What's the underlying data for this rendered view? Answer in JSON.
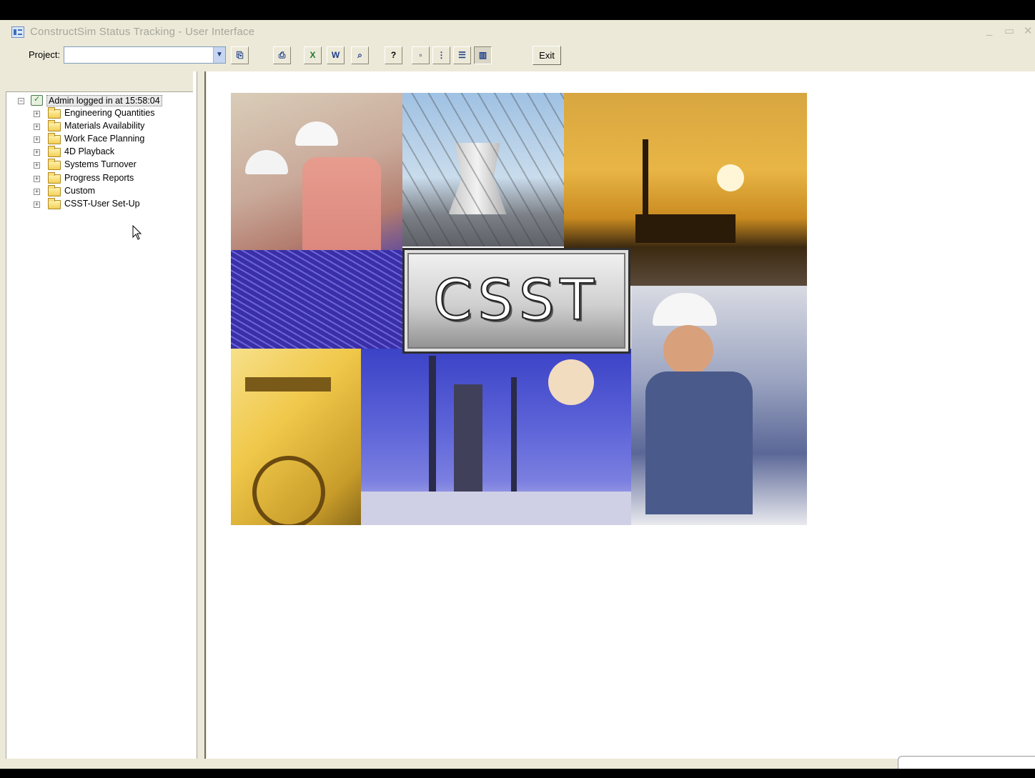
{
  "window": {
    "title": "ConstructSim Status Tracking - User Interface",
    "controls": {
      "minimize": "_",
      "maximize": "▭",
      "close": "✕"
    }
  },
  "toolbar": {
    "project_label": "Project:",
    "project_value": "",
    "exit_label": "Exit",
    "buttons": [
      {
        "name": "open-project-button",
        "glyph": "⎘"
      },
      {
        "name": "print-button",
        "glyph": "⎙"
      },
      {
        "name": "export-excel-button",
        "glyph": "X"
      },
      {
        "name": "export-word-button",
        "glyph": "W"
      },
      {
        "name": "preview-button",
        "glyph": "⌕"
      },
      {
        "name": "help-button",
        "glyph": "?"
      },
      {
        "name": "view-large-icons-button",
        "glyph": "▫"
      },
      {
        "name": "view-small-icons-button",
        "glyph": "⋮"
      },
      {
        "name": "view-list-button",
        "glyph": "☰"
      },
      {
        "name": "view-details-button",
        "glyph": "▥"
      }
    ]
  },
  "tree": {
    "root": {
      "label": "Admin logged in at 15:58:04",
      "expander": "−"
    },
    "items": [
      {
        "label": "Engineering Quantities",
        "expander": "+"
      },
      {
        "label": "Materials Availability",
        "expander": "+"
      },
      {
        "label": "Work Face Planning",
        "expander": "+"
      },
      {
        "label": "4D Playback",
        "expander": "+"
      },
      {
        "label": "Systems Turnover",
        "expander": "+"
      },
      {
        "label": "Progress Reports",
        "expander": "+"
      },
      {
        "label": "Custom",
        "expander": "+"
      },
      {
        "label": "CSST-User Set-Up",
        "expander": "+"
      }
    ]
  },
  "splash": {
    "logo_text": "CSST"
  },
  "colors": {
    "chrome": "#ece9d8",
    "accent_blue": "#1f3f8a",
    "folder": "#f3cf55"
  }
}
